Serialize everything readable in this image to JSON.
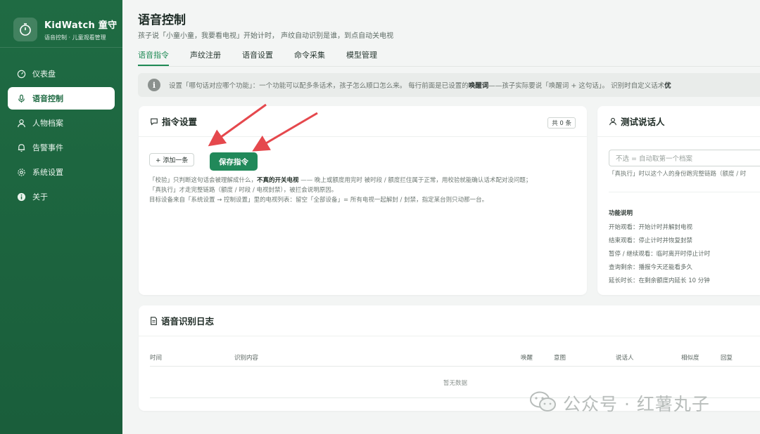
{
  "app": {
    "brand_title": "KidWatch 童守",
    "brand_subtitle": "语音控制 · 儿童观看管理"
  },
  "sidebar": {
    "items": [
      {
        "label": "仪表盘",
        "icon": "dashboard-icon",
        "active": false
      },
      {
        "label": "语音控制",
        "icon": "microphone-icon",
        "active": true
      },
      {
        "label": "人物档案",
        "icon": "person-icon",
        "active": false
      },
      {
        "label": "告警事件",
        "icon": "bell-icon",
        "active": false
      },
      {
        "label": "系统设置",
        "icon": "gear-icon",
        "active": false
      },
      {
        "label": "关于",
        "icon": "info-icon",
        "active": false
      }
    ]
  },
  "header": {
    "title": "语音控制",
    "subtitle": "孩子说「小童小童，我要看电视」开始计时， 声纹自动识别是谁，到点自动关电视"
  },
  "tabs": [
    {
      "label": "语音指令",
      "active": true
    },
    {
      "label": "声纹注册",
      "active": false
    },
    {
      "label": "语音设置",
      "active": false
    },
    {
      "label": "命令采集",
      "active": false
    },
    {
      "label": "模型管理",
      "active": false
    }
  ],
  "info_bar": {
    "text_pre": "设置「哪句话对应哪个功能」：一个功能可以配多条话术，孩子怎么顺口怎么来。  每行前面是已设置的",
    "bold1": "唤醒词",
    "text_mid": "——孩子实际要说「唤醒词 + 这句话」。  识别时自定义话术",
    "bold2": "优"
  },
  "command_card": {
    "title": "指令设置",
    "count_badge": "共 0 条",
    "add_label": "+ 添加一条",
    "save_label": "保存指令",
    "help_line1_a": "「校验」只判断这句话会被理解成什么，",
    "help_line1_b": "不真的开关电视",
    "help_line1_c": " —— 晚上或额度用完时 被时段 / 额度拦住属于正常，用校验就能确认话术配对没问题；",
    "help_line2": "「真执行」才走完整链路（额度 / 时段 / 电视封禁），被拦会说明原因。",
    "help_line3": "目标设备来自「系统设置 → 控制设置」里的电视列表：留空「全部设备」= 所有电视一起解封 / 封禁，指定某台则只动那一台。"
  },
  "speaker_card": {
    "title": "测试说话人",
    "input_placeholder": "不选 = 自动取第一个档案",
    "hint": "「真执行」时以这个人的身份跑完整链路（额度 / 时",
    "func_title": "功能说明",
    "functions": [
      "开始观看：开始计时并解封电视",
      "结束观看：停止计时并恢复封禁",
      "暂停 / 继续观看：临时离开时停止计时",
      "查询剩余：播报今天还能看多久",
      "延长时长：在剩余额度内延长 10 分钟"
    ]
  },
  "log_card": {
    "title": "语音识别日志",
    "columns": [
      "时间",
      "识别内容",
      "唤醒",
      "意图",
      "说话人",
      "相似度",
      "回复"
    ],
    "empty_text": "暂无数据"
  },
  "watermark": {
    "text": "公众号 · 红薯丸子"
  },
  "colors": {
    "sidebar": "#1f6b43",
    "accent": "#21895a",
    "arrow": "#e5484d"
  }
}
